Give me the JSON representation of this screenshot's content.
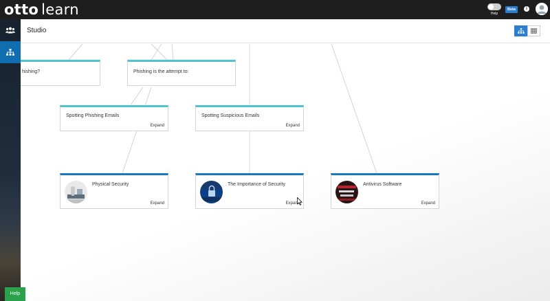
{
  "app": {
    "logo_bold": "otto",
    "logo_light": "learn",
    "help_toggle_label": "Help",
    "beta_label": "Beta",
    "avatar_icon": "user-avatar-icon"
  },
  "sidebar": {
    "items": [
      {
        "name": "users",
        "icon": "users-icon",
        "active": false
      },
      {
        "name": "hierarchy",
        "icon": "hierarchy-icon",
        "active": true
      }
    ],
    "help_button_label": "Help"
  },
  "page": {
    "title": "Studio",
    "view_modes": [
      {
        "name": "hierarchy-view",
        "icon": "hierarchy-icon",
        "active": true
      },
      {
        "name": "grid-view",
        "icon": "grid-icon",
        "active": false
      }
    ]
  },
  "cards": [
    {
      "title": "Phishing?",
      "visible_title": "hishing?",
      "expand": "",
      "style": "light"
    },
    {
      "title": "Phishing is the attempt to:",
      "expand": "",
      "style": "light"
    },
    {
      "title": "Spotting Phishing Emails",
      "expand": "Expand",
      "style": "light"
    },
    {
      "title": "Spotting Suspicious Emails",
      "expand": "Expand",
      "style": "light"
    },
    {
      "title": "Physical Security",
      "expand": "Expand",
      "style": "dark"
    },
    {
      "title": "The Importance of Security",
      "expand": "Expand",
      "style": "dark"
    },
    {
      "title": "Antivirus Software",
      "expand": "Expand",
      "style": "dark"
    }
  ],
  "colors": {
    "accent": "#2a7fd4",
    "card_light_top": "#4fc3d0",
    "card_dark_top": "#1a78c2",
    "topbar": "#1e1e1e",
    "help_button": "#2aa14b"
  }
}
